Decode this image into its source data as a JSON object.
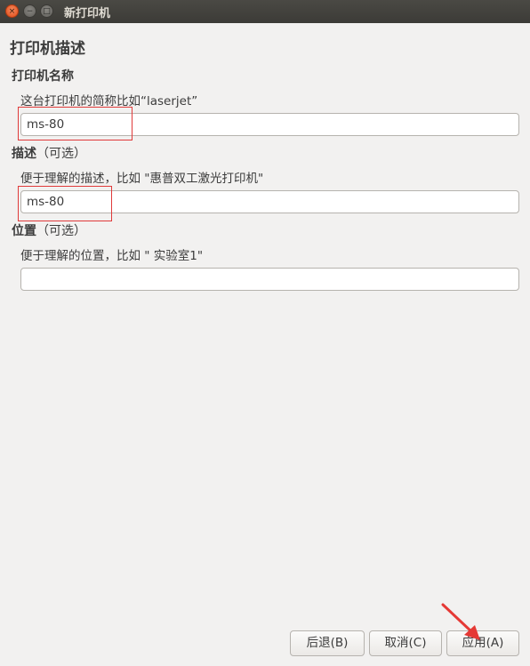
{
  "window": {
    "title": "新打印机",
    "close_glyph": "×",
    "minimize_glyph": "−",
    "maximize_glyph": "□"
  },
  "page_title": "打印机描述",
  "printer_name": {
    "label": "打印机名称",
    "hint": "这台打印机的简称比如“laserjet”",
    "value": "ms-80"
  },
  "description": {
    "label": "描述",
    "optional": "（可选）",
    "hint": "便于理解的描述，比如 \"惠普双工激光打印机\"",
    "value": "ms-80"
  },
  "location": {
    "label": "位置",
    "optional": "（可选）",
    "hint": "便于理解的位置，比如 \" 实验室1\"",
    "value": ""
  },
  "buttons": {
    "back": "后退(B)",
    "cancel": "取消(C)",
    "apply": "应用(A)"
  },
  "colors": {
    "highlight": "#e03a3a",
    "arrow": "#e53935"
  }
}
